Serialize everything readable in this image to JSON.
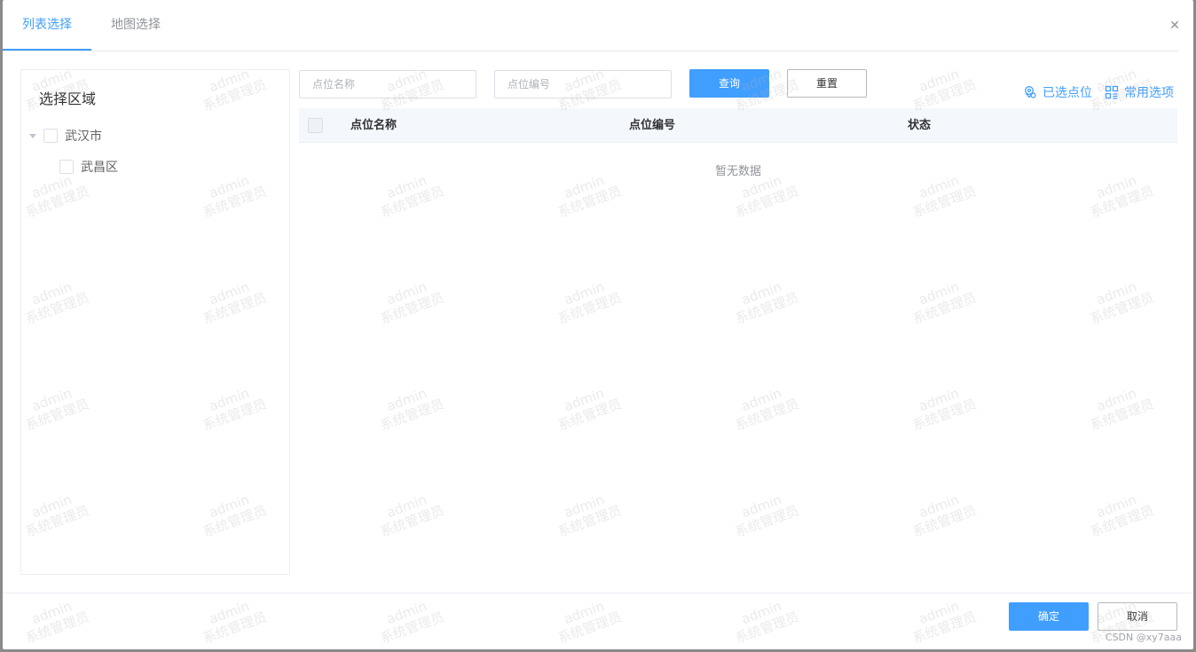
{
  "tabs": [
    {
      "label": "列表选择",
      "active": true
    },
    {
      "label": "地图选择",
      "active": false
    }
  ],
  "close_icon": "close-icon",
  "region": {
    "title": "选择区域",
    "tree": [
      {
        "label": "武汉市",
        "level": 0,
        "expanded": true
      },
      {
        "label": "武昌区",
        "level": 1
      }
    ]
  },
  "search": {
    "name_placeholder": "点位名称",
    "code_placeholder": "点位编号",
    "query_label": "查询",
    "reset_label": "重置"
  },
  "actions": {
    "selected_points_label": "已选点位",
    "common_options_label": "常用选项"
  },
  "table": {
    "columns": [
      "点位名称",
      "点位编号",
      "状态"
    ],
    "rows": [],
    "empty_text": "暂无数据"
  },
  "footer": {
    "confirm_label": "确定",
    "cancel_label": "取消"
  },
  "watermark": {
    "line1": "admin",
    "line2": "系统管理员"
  },
  "credit": "CSDN @xy7aaa",
  "colors": {
    "accent": "#409eff",
    "header_bg": "#f4f7fc",
    "border": "#ebeef5"
  }
}
